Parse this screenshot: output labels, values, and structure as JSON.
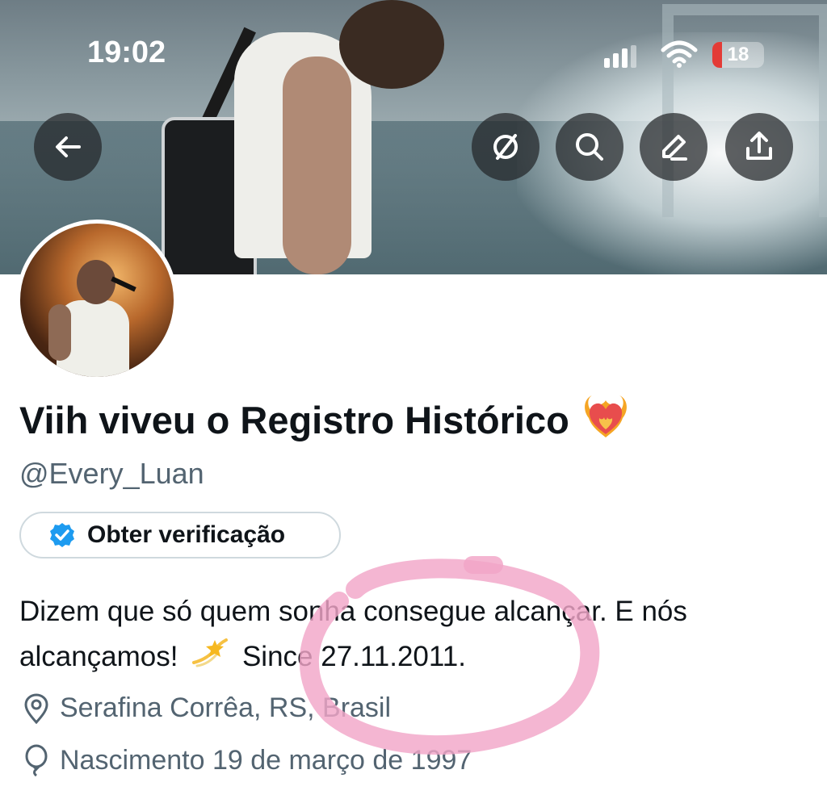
{
  "status_bar": {
    "time": "19:02",
    "battery_level": "18",
    "battery_color": "#e33b36"
  },
  "header_actions": {
    "back_icon": "arrow-left-icon",
    "grok_icon": "slashed-circle-icon",
    "search_icon": "search-icon",
    "edit_icon": "pencil-icon",
    "share_icon": "share-icon"
  },
  "profile": {
    "display_name": "Viih viveu o Registro Histórico",
    "name_emoji": "heart-on-fire",
    "handle": "@Every_Luan",
    "verify_button_label": "Obter verificação",
    "bio_part1": "Dizem que só quem sonha consegue alcançar. E nós alcançamos!",
    "bio_emoji": "dizzy",
    "bio_part2": "Since 27.11.2011.",
    "location": "Serafina Corrêa, RS, Brasil",
    "birth": "Nascimento 19 de março de 1997"
  },
  "colors": {
    "text_primary": "#0f1419",
    "text_secondary": "#536471",
    "verified_blue": "#1d9bf0",
    "annotation_pink": "#f2a6c8"
  }
}
